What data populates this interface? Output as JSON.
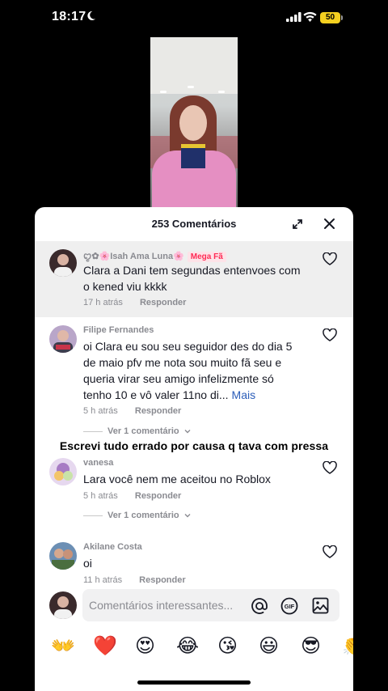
{
  "status_bar": {
    "time": "18:17",
    "battery": "50"
  },
  "sheet": {
    "title": "253 Comentários"
  },
  "comments": [
    {
      "username": "ꨄ✿🌸Isah Ama Luna🌸",
      "badge": "Mega Fã",
      "text": "Clara a Dani tem segundas entenvoes com o kened viu kkkk",
      "time": "17 h atrás",
      "reply": "Responder"
    },
    {
      "username": "Filipe Fernandes",
      "text": "oi Clara eu sou seu seguidor des do dia 5 de maio pfv me nota sou muito fã seu e queria virar seu amigo infelizmente só tenho 10 e vô valer 11no di...",
      "more": "Mais",
      "time": "5 h atrás",
      "reply": "Responder",
      "view_replies": "Ver 1 comentário"
    },
    {
      "username": "vanesa",
      "text": "Lara você nem me aceitou no Roblox",
      "time": "5 h atrás",
      "reply": "Responder",
      "view_replies": "Ver 1 comentário"
    },
    {
      "username": "Akilane Costa",
      "text": "oi",
      "time": "11 h atrás",
      "reply": "Responder"
    }
  ],
  "overlay_caption": "Escrevi tudo errado por causa q tava com pressa",
  "input": {
    "placeholder": "Comentários interessantes..."
  },
  "emojis": [
    "👐",
    "❤️",
    "😍",
    "😂",
    "😘",
    "😃",
    "😎",
    "👏"
  ],
  "colors": {
    "accent": "#fe2c55",
    "link": "#2b5db9",
    "muted": "#8a8b91",
    "highlight_bg": "#efefef"
  }
}
